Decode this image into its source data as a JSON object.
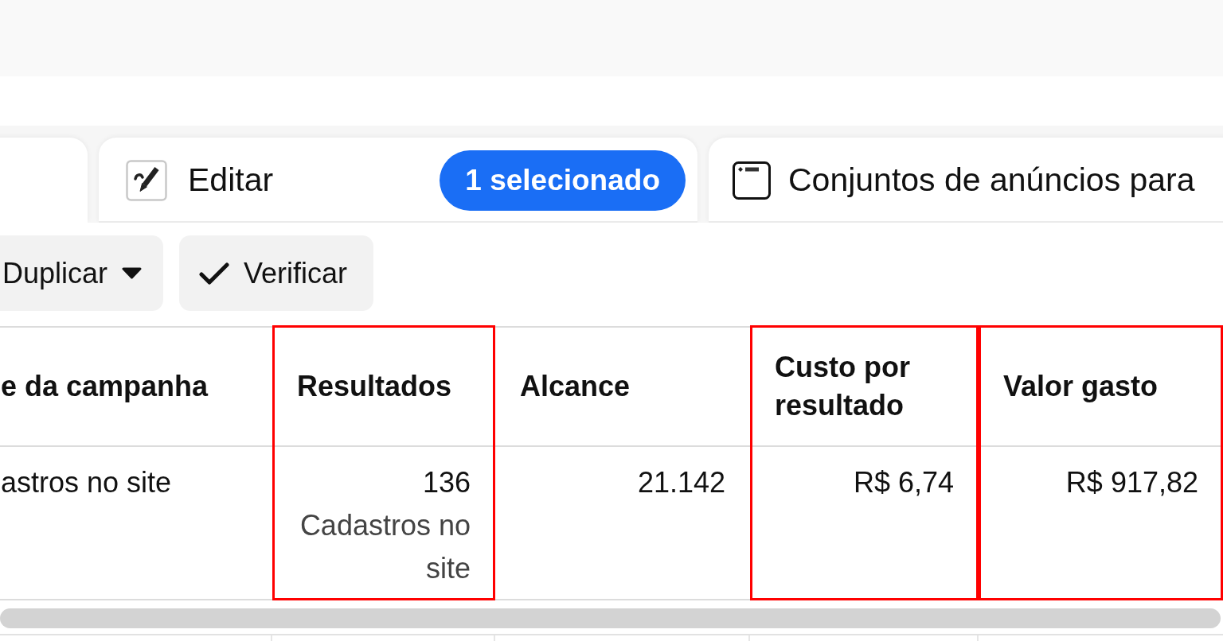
{
  "tabs": [
    {
      "selected": true
    },
    {
      "kind": "edit",
      "label": "Editar",
      "badge": "1 selecionado",
      "selected": false
    },
    {
      "kind": "window",
      "label": "Conjuntos de anúncios para",
      "selected": false
    }
  ],
  "toolbar": [
    {
      "kind": "dropdown",
      "label": "Duplicar"
    },
    {
      "kind": "check",
      "label": "Verificar"
    }
  ],
  "table": {
    "columns": [
      {
        "label": "e da campanha",
        "kind": "text",
        "highlighted": false
      },
      {
        "label": "Resultados",
        "kind": "metric",
        "highlighted": true
      },
      {
        "label": "Alcance",
        "kind": "metric",
        "highlighted": false
      },
      {
        "label": "Custo por resultado",
        "kind": "metric",
        "highlighted": true
      },
      {
        "label": "Valor gasto",
        "kind": "metric",
        "highlighted": true
      }
    ],
    "rows": [
      {
        "cells": [
          {
            "value": "astros no site"
          },
          {
            "value": "136",
            "subtext": "Cadastros no site"
          },
          {
            "value": "21.142"
          },
          {
            "value": "R$ 6,74"
          },
          {
            "value": "R$ 917,82"
          }
        ]
      }
    ]
  }
}
